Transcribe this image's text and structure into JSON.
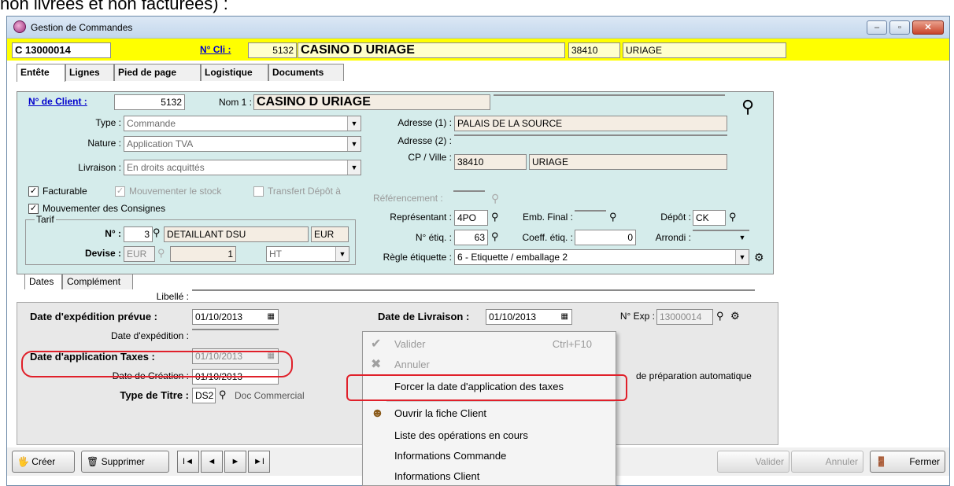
{
  "top_text": "non livrées et non facturées) :",
  "window": {
    "title": "Gestion de Commandes",
    "btn_min": "–",
    "btn_max": "▫",
    "btn_close": "✕"
  },
  "header": {
    "order_no": "C 13000014",
    "client_link": "N° Cli :",
    "client_no": "5132",
    "client_name": "CASINO D URIAGE",
    "postal_code": "38410",
    "city": "URIAGE"
  },
  "tabs": [
    "Entête",
    "Lignes",
    "Pied de page",
    "Logistique",
    "Documents"
  ],
  "entete": {
    "client_link": "N° de Client :",
    "client_no": "5132",
    "nom1_label": "Nom 1 :",
    "nom1": "CASINO D URIAGE",
    "nom2": "",
    "type_label": "Type :",
    "type": "Commande",
    "nature_label": "Nature :",
    "nature": "Application TVA",
    "livraison_label": "Livraison :",
    "livraison": "En droits acquittés",
    "adresse1_label": "Adresse (1) :",
    "adresse1": "PALAIS DE LA SOURCE",
    "adresse2_label": "Adresse (2) :",
    "adresse2": "",
    "cpville_label": "CP / Ville :",
    "cp": "38410",
    "ville": "URIAGE",
    "facturable": "Facturable",
    "mouvementer_stock": "Mouvementer le stock",
    "transfert_depot": "Transfert Dépôt à",
    "referencement": "Référencement :",
    "mouv_consignes": "Mouvementer des Consignes",
    "tarif_group": "Tarif",
    "no_label": "N° :",
    "tarif_no": "3",
    "tarif_name": "DETAILLANT DSU",
    "tarif_currency": "EUR",
    "devise_label": "Devise :",
    "devise": "EUR",
    "devise_rate": "1",
    "ht": "HT",
    "representant_label": "Représentant :",
    "representant": "4PO",
    "emb_final_label": "Emb. Final :",
    "emb_final": "",
    "depot_label": "Dépôt :",
    "depot": "CK",
    "n_etiq_label": "N° étiq. :",
    "n_etiq": "63",
    "coeff_label": "Coeff. étiq. :",
    "coeff": "0",
    "arrondi_label": "Arrondi :",
    "arrondi": "",
    "regle_label": "Règle étiquette :",
    "regle": "6 - Etiquette / emballage 2"
  },
  "subtabs": [
    "Dates",
    "Complément"
  ],
  "dates": {
    "libelle_label": "Libellé :",
    "libelle": "",
    "exp_prevue_label": "Date d'expédition prévue :",
    "exp_prevue": "01/10/2013",
    "livraison_label": "Date de Livraison :",
    "livraison": "01/10/2013",
    "nexp_label": "N° Exp :",
    "nexp": "13000014",
    "expedition_label": "Date d'expédition :",
    "expedition": "",
    "taxes_label": "Date d'application Taxes :",
    "taxes": "01/10/2013",
    "creation_label": "Date de Création :",
    "creation": "01/10/2013",
    "titre_label": "Type de Titre :",
    "titre": "DS2",
    "titre_desc": "Doc Commercial",
    "prep_auto": "de préparation automatique"
  },
  "context_menu": {
    "items": [
      {
        "label": "Valider",
        "shortcut": "Ctrl+F10",
        "icon": "check-icon",
        "disabled": true
      },
      {
        "label": "Annuler",
        "shortcut": "",
        "icon": "x-icon",
        "disabled": true
      },
      {
        "label": "Forcer la date d'application des taxes",
        "shortcut": "",
        "icon": "",
        "disabled": false
      },
      {
        "label": "Ouvrir la fiche Client",
        "shortcut": "",
        "icon": "client-icon",
        "disabled": false
      },
      {
        "label": "Liste des opérations en cours",
        "shortcut": "",
        "icon": "",
        "disabled": false
      },
      {
        "label": "Informations Commande",
        "shortcut": "",
        "icon": "",
        "disabled": false
      },
      {
        "label": "Informations Client",
        "shortcut": "",
        "icon": "",
        "disabled": false
      }
    ]
  },
  "toolbar": {
    "creer": "Créer",
    "supprimer": "Supprimer",
    "nav_first": "I◄",
    "nav_prev": "◄",
    "nav_next": "►",
    "nav_last": "►I",
    "valider": "Valider",
    "annuler": "Annuler",
    "fermer": "Fermer"
  }
}
